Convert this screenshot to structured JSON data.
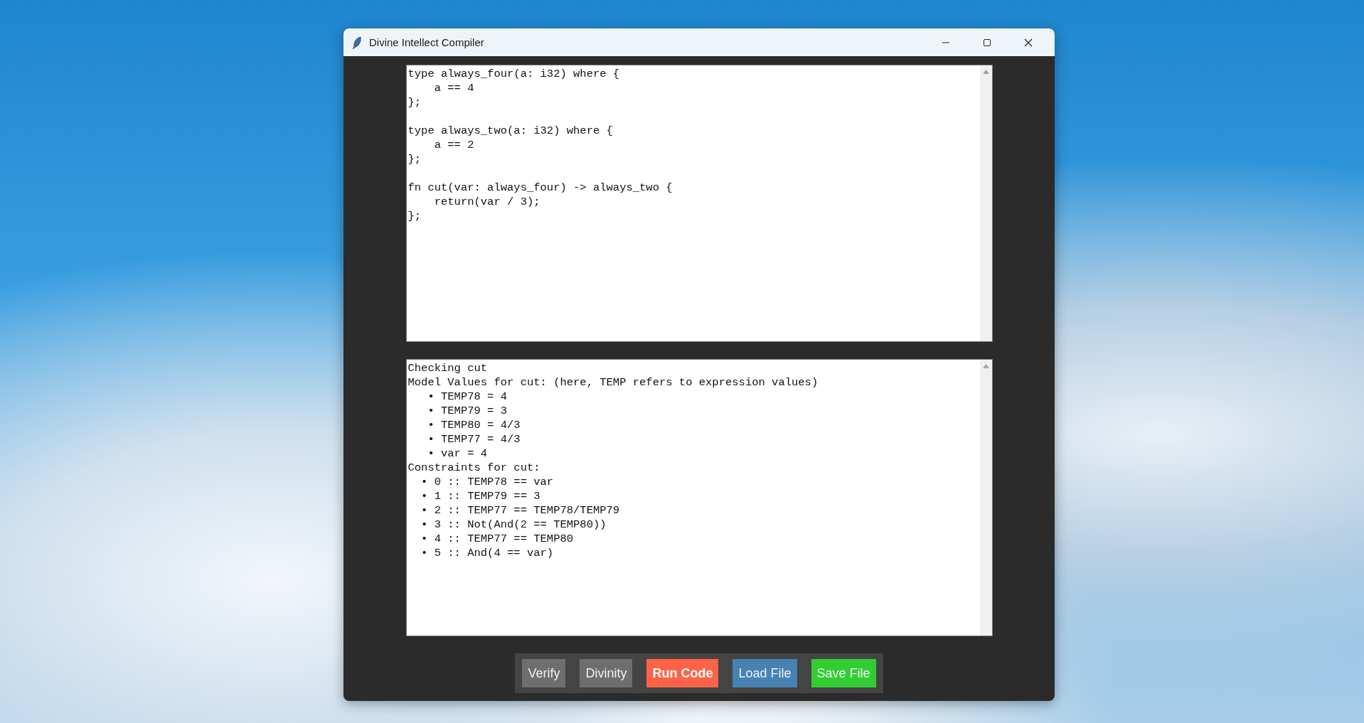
{
  "window": {
    "title": "Divine Intellect Compiler"
  },
  "editor": {
    "blocks": [
      [
        "type always_four(a: i32) where {",
        "    a == 4",
        "};"
      ],
      [
        "type always_two(a: i32) where {",
        "    a == 2",
        "};"
      ],
      [
        "fn cut(var: always_four) -> always_two {",
        "    return(var / 3);",
        "};"
      ]
    ]
  },
  "output": {
    "lines": [
      "Checking cut",
      "Model Values for cut: (here, TEMP refers to expression values)",
      "   • TEMP78 = 4",
      "   • TEMP79 = 3",
      "   • TEMP80 = 4/3",
      "   • TEMP77 = 4/3",
      "   • var = 4",
      "Constraints for cut:",
      "  • 0 :: TEMP78 == var",
      "  • 1 :: TEMP79 == 3",
      "  • 2 :: TEMP77 == TEMP78/TEMP79",
      "  • 3 :: Not(And(2 == TEMP80))",
      "  • 4 :: TEMP77 == TEMP80",
      "  • 5 :: And(4 == var)"
    ]
  },
  "buttons": [
    {
      "label": "Verify",
      "kind": "plain",
      "color": "#6e6e6e"
    },
    {
      "label": "Divinity",
      "kind": "plain",
      "color": "#6e6e6e"
    },
    {
      "label": "Run Code",
      "kind": "primary",
      "color": "#ff6347"
    },
    {
      "label": "Load File",
      "kind": "plain",
      "color": "#4682b4"
    },
    {
      "label": "Save File",
      "kind": "plain",
      "color": "#32cd32"
    }
  ]
}
